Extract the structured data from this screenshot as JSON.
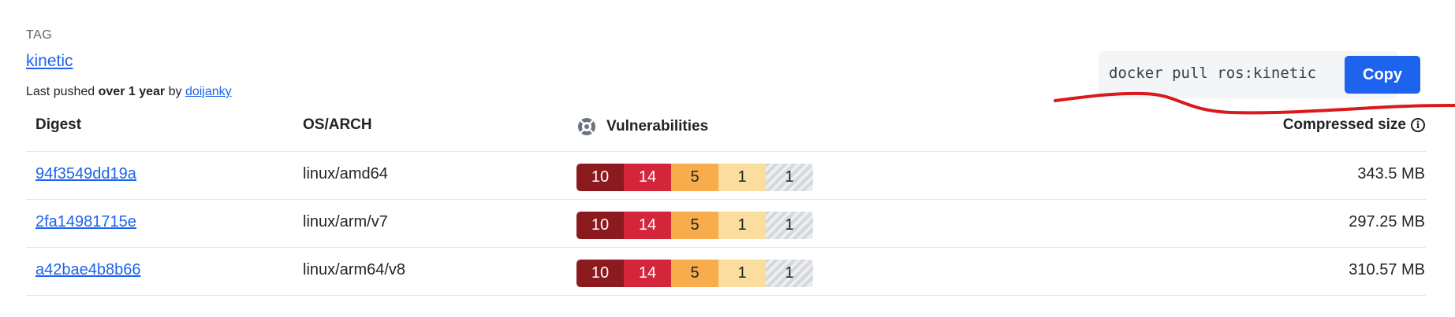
{
  "tag": {
    "label": "TAG",
    "name": "kinetic",
    "pushed_prefix": "Last pushed ",
    "pushed_when": "over 1 year",
    "pushed_by_prefix": " by ",
    "pushed_by": "doijanky"
  },
  "pull": {
    "command": "docker pull ros:kinetic",
    "copy_label": "Copy"
  },
  "table": {
    "headers": {
      "digest": "Digest",
      "os_arch": "OS/ARCH",
      "vulnerabilities": "Vulnerabilities",
      "compressed_size": "Compressed size"
    },
    "rows": [
      {
        "digest": "94f3549dd19a",
        "os_arch": "linux/amd64",
        "vulns": {
          "critical": "10",
          "high": "14",
          "medium": "5",
          "low": "1",
          "unspecified": "1"
        },
        "size": "343.5 MB"
      },
      {
        "digest": "2fa14981715e",
        "os_arch": "linux/arm/v7",
        "vulns": {
          "critical": "10",
          "high": "14",
          "medium": "5",
          "low": "1",
          "unspecified": "1"
        },
        "size": "297.25 MB"
      },
      {
        "digest": "a42bae4b8b66",
        "os_arch": "linux/arm64/v8",
        "vulns": {
          "critical": "10",
          "high": "14",
          "medium": "5",
          "low": "1",
          "unspecified": "1"
        },
        "size": "310.57 MB"
      }
    ]
  },
  "colors": {
    "link": "#1d63ed",
    "critical": "#8b1a1f",
    "high": "#d3263a",
    "medium": "#f7ad4b",
    "low": "#fbdda0",
    "annotation": "#d9191c"
  },
  "icons": {
    "vulnerabilities": "scout-icon",
    "compressed_size_info": "info-icon"
  }
}
